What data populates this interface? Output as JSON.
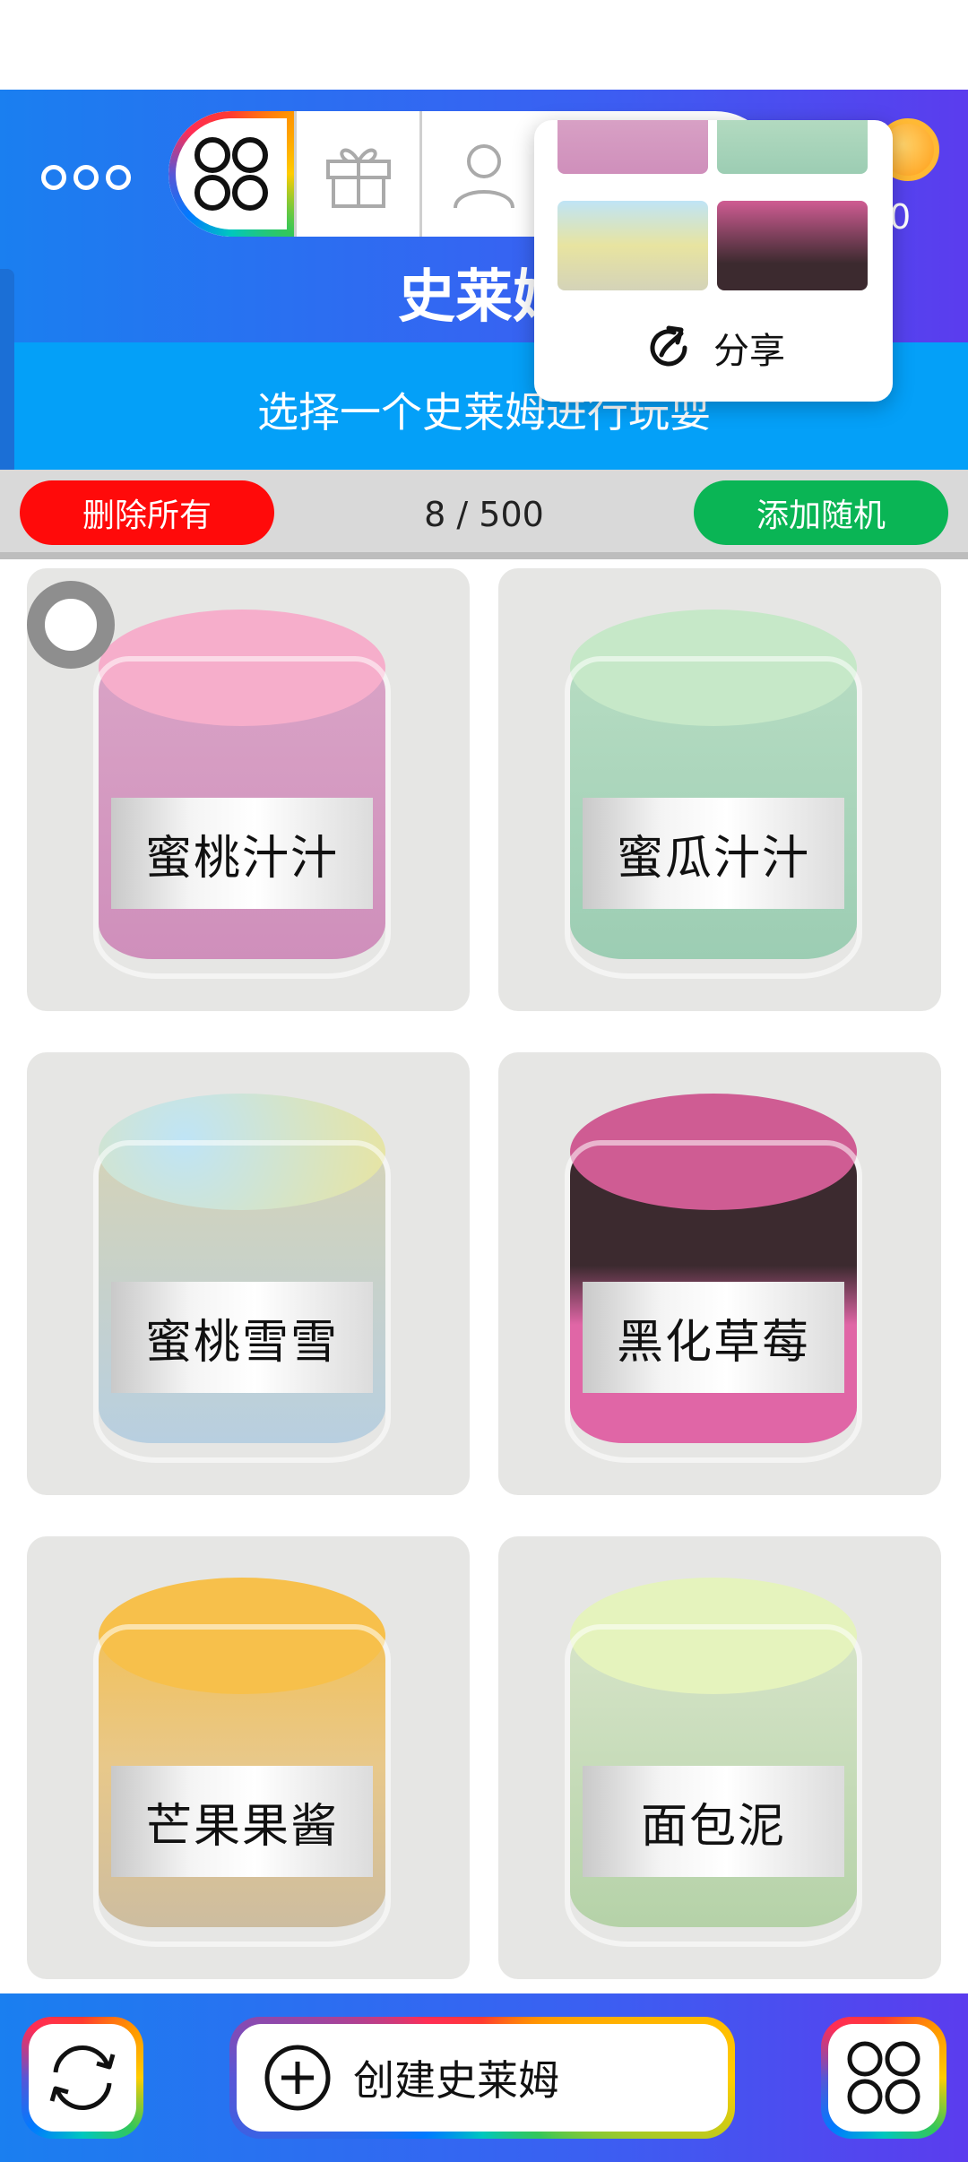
{
  "header": {
    "title": "史莱姆",
    "subtitle": "选择一个史莱姆进行玩耍",
    "coin_count": "0",
    "tabs": [
      {
        "icon": "four-circles-icon"
      },
      {
        "icon": "gift-icon"
      },
      {
        "icon": "user-icon"
      }
    ]
  },
  "popup": {
    "share_label": "分享"
  },
  "action_bar": {
    "delete_all_label": "删除所有",
    "count": "8 / 500",
    "add_random_label": "添加随机"
  },
  "slimes": [
    {
      "name": "蜜桃汁汁",
      "top_color": "#f6aecb",
      "body_color": "#d9a3c6",
      "bottom_color": "#cf8fbb"
    },
    {
      "name": "蜜瓜汁汁",
      "top_color": "#c6e8c8",
      "body_color": "#b6dcc2",
      "bottom_color": "#9ccdb3"
    },
    {
      "name": "蜜桃雪雪",
      "top_color": "#e8e4a0",
      "body_color": "#d4d3b8",
      "bottom_color": "#b8cfe0"
    },
    {
      "name": "黑化草莓",
      "top_color": "#cf5c93",
      "body_color": "#3c2a2f",
      "bottom_color": "#e066a6"
    },
    {
      "name": "芒果果酱",
      "top_color": "#f7c04b",
      "body_color": "#e8c88a",
      "bottom_color": "#cdbda0"
    },
    {
      "name": "面包泥",
      "top_color": "#e5f3bd",
      "body_color": "#d6e4c8",
      "bottom_color": "#b5d2a8"
    }
  ],
  "bottom_bar": {
    "create_label": "创建史莱姆",
    "refresh_icon": "refresh-icon",
    "menu_icon": "four-circles-icon"
  },
  "colors": {
    "header_gradient_start": "#1a7ff0",
    "header_gradient_end": "#5b3cee",
    "subtitle_band": "#04a0f8",
    "delete_button": "#ff0a0a",
    "random_button": "#0ab555",
    "card_bg": "#e6e6e4"
  }
}
